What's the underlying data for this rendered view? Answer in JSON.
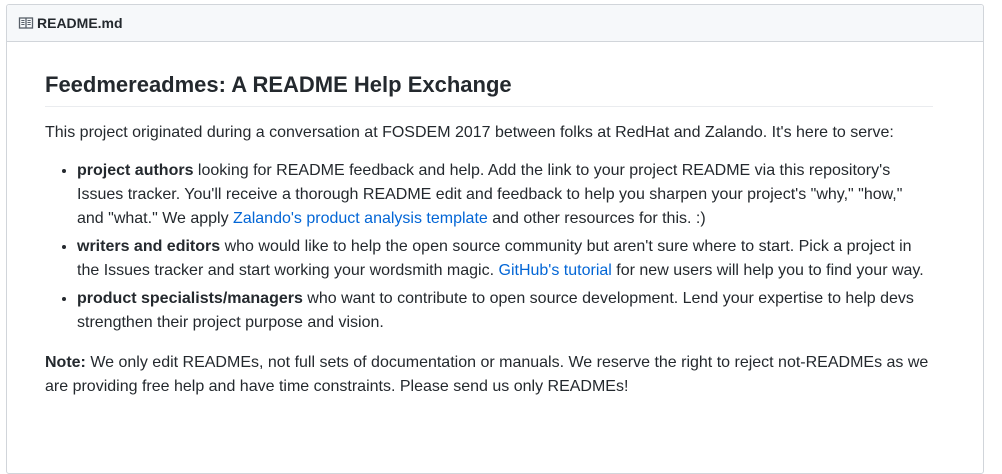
{
  "file": {
    "name": "README.md",
    "icon": "book-icon"
  },
  "readme": {
    "title": "Feedmereadmes: A README Help Exchange",
    "intro": "This project originated during a conversation at FOSDEM 2017 between folks at RedHat and Zalando. It's here to serve:",
    "items": [
      {
        "bold": "project authors",
        "text_before_link": " looking for README feedback and help. Add the link to your project README via this repository's Issues tracker. You'll receive a thorough README edit and feedback to help you sharpen your project's \"why,\" \"how,\" and \"what.\" We apply ",
        "link": "Zalando's product analysis template",
        "text_after_link": " and other resources for this. :)"
      },
      {
        "bold": "writers and editors",
        "text_before_link": " who would like to help the open source community but aren't sure where to start. Pick a project in the Issues tracker and start working your wordsmith magic. ",
        "link": "GitHub's tutorial",
        "text_after_link": " for new users will help you to find your way."
      },
      {
        "bold": "product specialists/managers",
        "text": " who want to contribute to open source development. Lend your expertise to help devs strengthen their project purpose and vision."
      }
    ],
    "note": {
      "label": "Note:",
      "text": " We only edit READMEs, not full sets of documentation or manuals. We reserve the right to reject not-READMEs as we are providing free help and have time constraints. Please send us only READMEs!"
    }
  },
  "colors": {
    "link": "#0366d6",
    "text": "#24292e",
    "header_bg": "#f6f8fa",
    "border": "#d1d5da"
  }
}
